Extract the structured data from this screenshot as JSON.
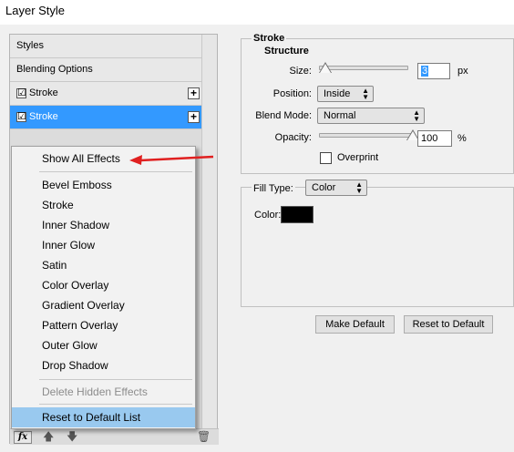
{
  "window": {
    "title": "Layer Style"
  },
  "styles_list": {
    "items": [
      {
        "label": "Styles"
      },
      {
        "label": "Blending Options"
      },
      {
        "label": "Stroke",
        "checked": true,
        "add_icon": "plus-icon"
      },
      {
        "label": "Stroke",
        "checked": true,
        "selected": true,
        "add_icon": "plus-icon"
      }
    ],
    "checkmark": "☑"
  },
  "bottom_bar": {
    "fx_label": "fx",
    "icons": [
      "fx-icon",
      "move-up-icon",
      "move-down-icon",
      "trash-icon"
    ]
  },
  "fx_menu": {
    "items": [
      {
        "label": "Show All Effects"
      },
      {
        "label": "Bevel  Emboss"
      },
      {
        "label": "Stroke"
      },
      {
        "label": "Inner Shadow"
      },
      {
        "label": "Inner Glow"
      },
      {
        "label": "Satin"
      },
      {
        "label": "Color Overlay"
      },
      {
        "label": "Gradient Overlay"
      },
      {
        "label": "Pattern Overlay"
      },
      {
        "label": "Outer Glow"
      },
      {
        "label": "Drop Shadow"
      },
      {
        "label": "Delete Hidden Effects",
        "disabled": true
      },
      {
        "label": "Reset to Default List",
        "highlighted": true
      }
    ]
  },
  "annotation": {
    "arrow_color": "#e02020",
    "icon": "red-arrow-icon"
  },
  "stroke_panel": {
    "title": "Stroke",
    "structure_title": "Structure",
    "size": {
      "label": "Size:",
      "value": "3",
      "unit": "px",
      "slider_level": 0.07
    },
    "position": {
      "label": "Position:",
      "value": "Inside"
    },
    "blend_mode": {
      "label": "Blend Mode:",
      "value": "Normal"
    },
    "opacity": {
      "label": "Opacity:",
      "value": "100",
      "unit": "%",
      "slider_level": 1.0
    },
    "overprint": {
      "label": "Overprint",
      "checked": false
    },
    "fill_type": {
      "label": "Fill Type:",
      "value": "Color"
    },
    "color": {
      "label": "Color:",
      "swatch": "#000000"
    },
    "buttons": {
      "make_default": "Make Default",
      "reset_default": "Reset to Default"
    }
  },
  "colors": {
    "selection": "#3399ff",
    "menu_highlight": "#99c9ef"
  }
}
